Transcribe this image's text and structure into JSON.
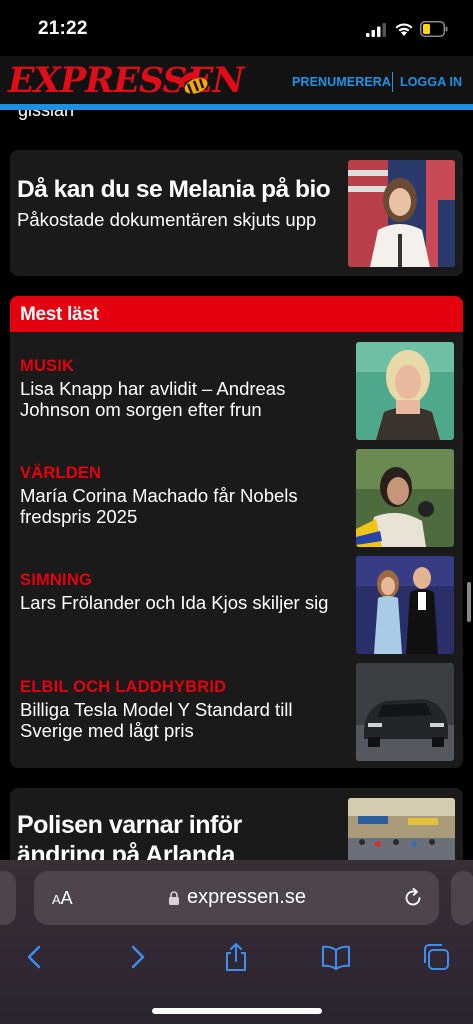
{
  "status_bar": {
    "time": "21:22"
  },
  "header": {
    "logo": "EXPRESSEN",
    "subscribe_label": "PRENUMERERA",
    "login_label": "LOGGA IN",
    "brand_color": "#e00d18",
    "link_color": "#1e95e5"
  },
  "content": {
    "cutoff_text": "gissian",
    "top_article": {
      "title": "Då kan du se Melania på bio",
      "subtitle": "Påkostade dokumentären skjuts upp"
    },
    "most_read": {
      "heading": "Mest läst",
      "items": [
        {
          "category": "MUSIK",
          "text": "Lisa Knapp har avlidit – Andreas Johnson om sorgen efter frun"
        },
        {
          "category": "VÄRLDEN",
          "text": "María Corina Machado får Nobels fredspris 2025"
        },
        {
          "category": "SIMNING",
          "text": "Lars Frölander och Ida Kjos skiljer sig"
        },
        {
          "category": "ELBIL OCH LADDHYBRID",
          "text": "Billiga Tesla Model Y Standard till Sverige med lågt pris"
        }
      ]
    },
    "bottom_article": {
      "title": "Polisen varnar inför ändring på Arlanda"
    }
  },
  "browser": {
    "aa_label": "AA",
    "url": "expressen.se"
  }
}
